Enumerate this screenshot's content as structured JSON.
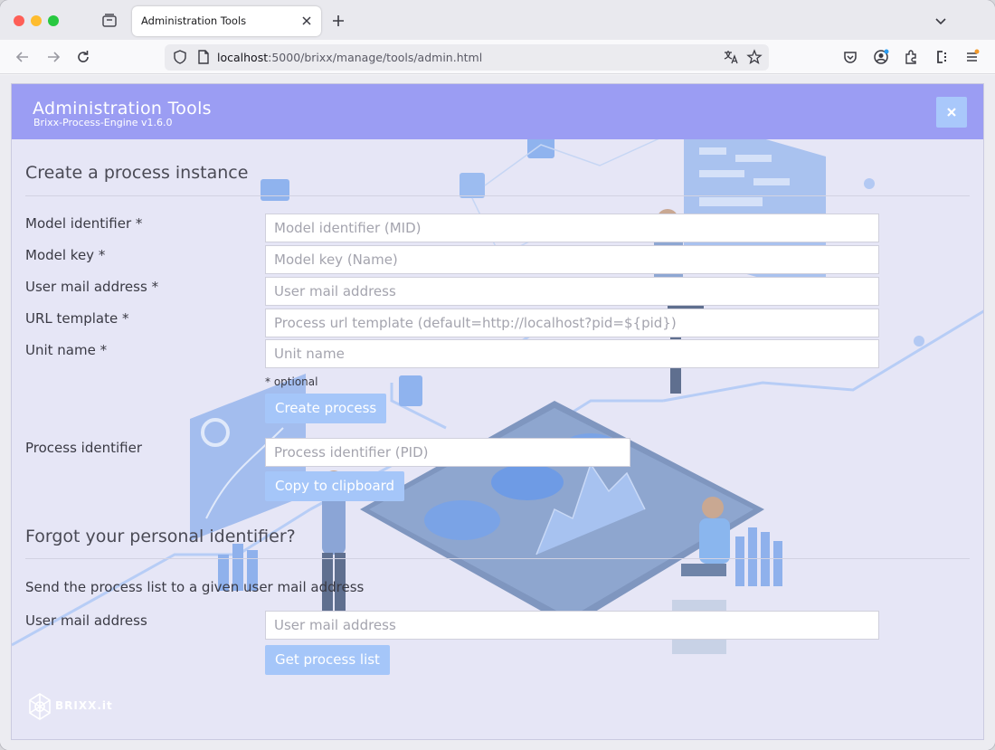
{
  "browser": {
    "tab_title": "Administration Tools",
    "url_host": "localhost",
    "url_path": ":5000/brixx/manage/tools/admin.html"
  },
  "header": {
    "title": "Administration Tools",
    "subtitle": "Brixx-Process-Engine v1.6.0",
    "close_label": "×"
  },
  "create": {
    "title": "Create a process instance",
    "fields": [
      {
        "label": "Model identifier *",
        "placeholder": "Model identifier (MID)"
      },
      {
        "label": "Model key *",
        "placeholder": "Model key (Name)"
      },
      {
        "label": "User mail address *",
        "placeholder": "User mail address"
      },
      {
        "label": "URL template *",
        "placeholder": "Process url template (default=http://localhost?pid=${pid})"
      },
      {
        "label": "Unit name *",
        "placeholder": "Unit name"
      }
    ],
    "optional_hint": "* optional",
    "create_button": "Create process",
    "pid_label": "Process identifier",
    "pid_placeholder": "Process identifier (PID)",
    "copy_button": "Copy to clipboard"
  },
  "forgot": {
    "title": "Forgot your personal identifier?",
    "description": "Send the process list to a given user mail address",
    "mail_label": "User mail address",
    "mail_placeholder": "User mail address",
    "get_button": "Get process list"
  },
  "brand": {
    "text": "BRIXX.it"
  },
  "colors": {
    "header": "#9b9df3",
    "button": "#a5c6f9",
    "accent": "#5fa3f5"
  }
}
